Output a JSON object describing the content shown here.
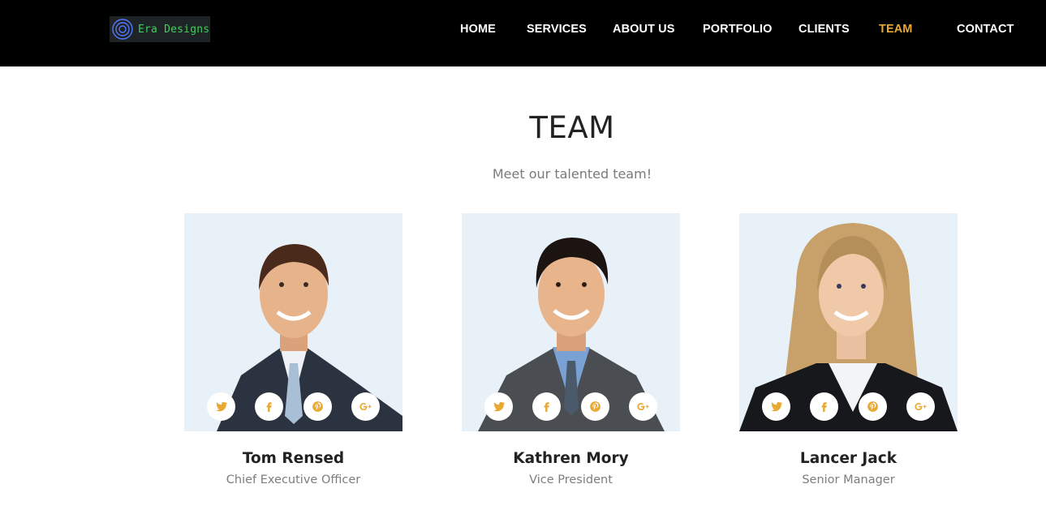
{
  "brand": {
    "name": "Era Designs"
  },
  "nav": {
    "items": [
      {
        "label": "HOME"
      },
      {
        "label": "SERVICES"
      },
      {
        "label": "ABOUT US"
      },
      {
        "label": "PORTFOLIO"
      },
      {
        "label": "CLIENTS"
      },
      {
        "label": "TEAM",
        "active": true
      },
      {
        "label": "CONTACT"
      }
    ]
  },
  "team": {
    "title": "TEAM",
    "subtitle": "Meet our talented team!",
    "members": [
      {
        "name": "Tom Rensed",
        "role": "Chief Executive Officer"
      },
      {
        "name": "Kathren Mory",
        "role": "Vice President"
      },
      {
        "name": "Lancer Jack",
        "role": "Senior Manager"
      }
    ],
    "social_icons": [
      "twitter-icon",
      "facebook-icon",
      "pinterest-icon",
      "google-plus-icon"
    ]
  },
  "colors": {
    "header_bg": "#000000",
    "accent": "#e8a933",
    "logo_text": "#3ecf5e",
    "photo_bg": "#e9f1f8"
  }
}
